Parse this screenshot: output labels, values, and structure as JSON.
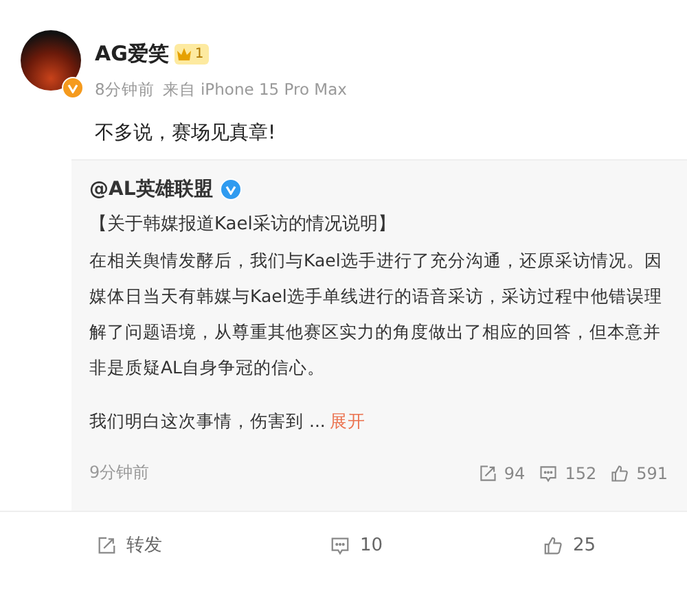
{
  "author": {
    "name": "AG爱笑",
    "level": "1",
    "time": "8分钟前",
    "source": "来自 iPhone 15 Pro Max",
    "verified": true
  },
  "text": "不多说，赛场见真章!",
  "quote": {
    "author": "@AL英雄联盟",
    "verified": true,
    "title": "【关于韩媒报道Kael采访的情况说明】",
    "body": "在相关舆情发酵后，我们与Kael选手进行了充分沟通，还原采访情况。因媒体日当天有韩媒与Kael选手单线进行的语音采访，采访过程中他错误理解了问题语境，从尊重其他赛区实力的角度做出了相应的回答，但本意并非是质疑AL自身争冠的信心。",
    "excerpt": "我们明白这次事情，伤害到 ...",
    "expand": "展开",
    "time": "9分钟前",
    "stats": [
      {
        "kind": "repost",
        "count": "94"
      },
      {
        "kind": "comment",
        "count": "152"
      },
      {
        "kind": "like",
        "count": "591"
      }
    ]
  },
  "actions": [
    {
      "kind": "repost",
      "label": "转发"
    },
    {
      "kind": "comment",
      "label": "10"
    },
    {
      "kind": "like",
      "label": "25"
    }
  ]
}
